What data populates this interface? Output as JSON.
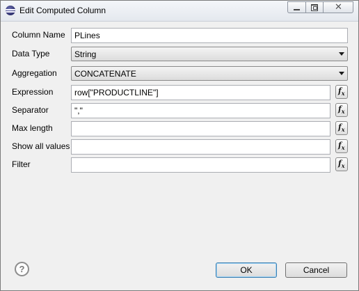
{
  "window": {
    "title": "Edit Computed Column",
    "controls": {
      "minimize": "minimize",
      "maximize": "maximize",
      "close": "✕"
    }
  },
  "form": {
    "column_name": {
      "label": "Column Name",
      "value": "PLines"
    },
    "data_type": {
      "label": "Data Type",
      "value": "String"
    },
    "aggregation": {
      "label": "Aggregation",
      "value": "CONCATENATE"
    },
    "expression": {
      "label": "Expression",
      "value": "row[\"PRODUCTLINE\"]"
    },
    "separator": {
      "label": "Separator",
      "value": "\",\""
    },
    "max_length": {
      "label": "Max length",
      "value": ""
    },
    "show_all_values": {
      "label": "Show all values",
      "value": ""
    },
    "filter": {
      "label": "Filter",
      "value": ""
    }
  },
  "icons": {
    "expression_builder": "fx-icon",
    "help": "question-mark-icon",
    "app": "eclipse-icon"
  },
  "footer": {
    "help_glyph": "?",
    "ok_label": "OK",
    "cancel_label": "Cancel"
  }
}
